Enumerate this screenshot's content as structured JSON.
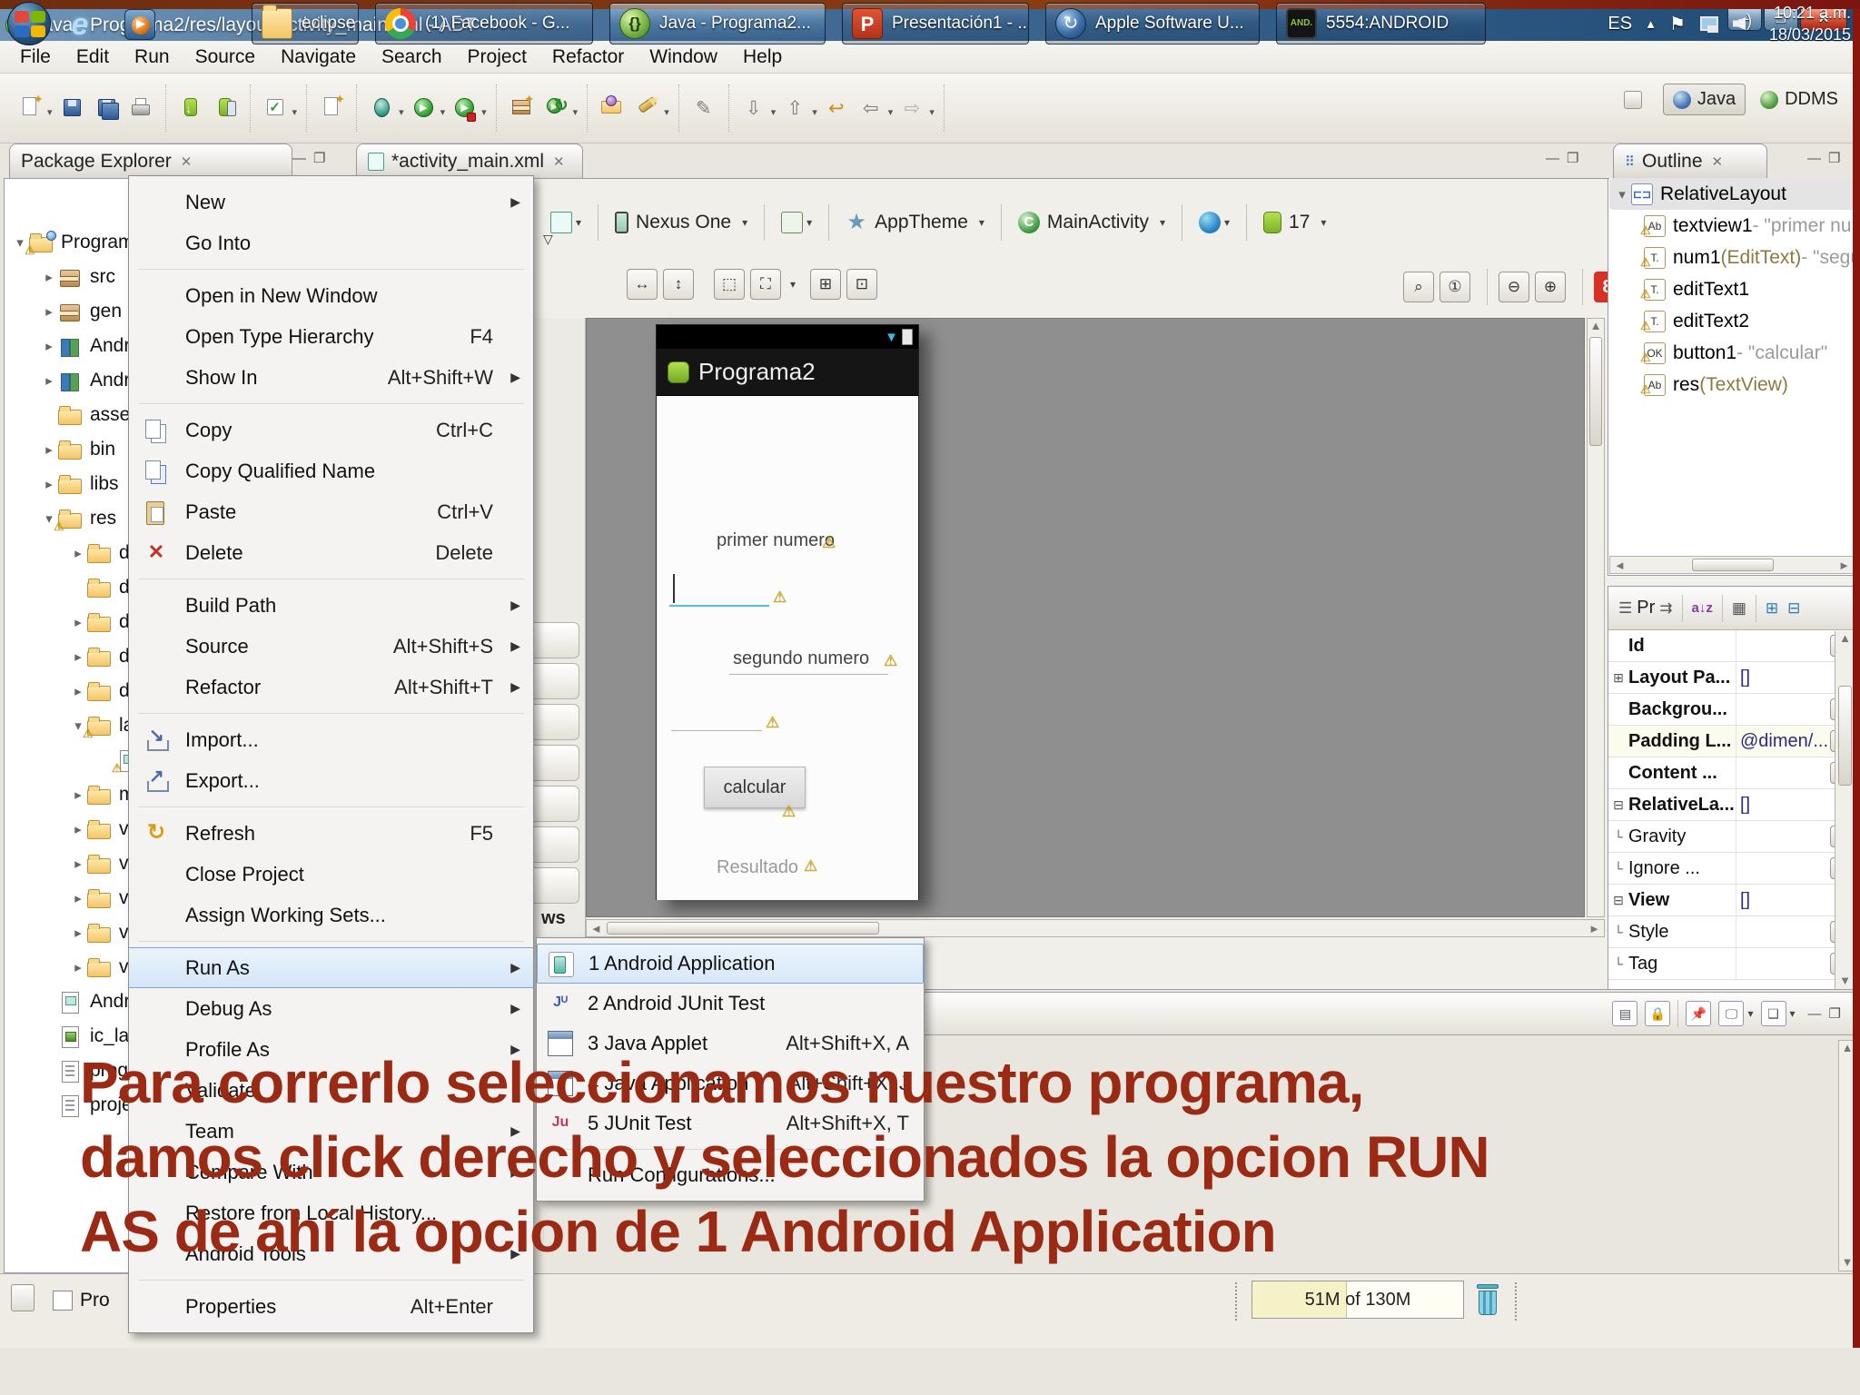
{
  "icons": {
    "warn": "⚠",
    "close": "✕",
    "minimize": "—",
    "maximize": "❐",
    "tab_close": "✕",
    "tri_c": "▸",
    "tri_e": "▾",
    "sub_arrow": "▶",
    "dd": "▾",
    "left": "◄",
    "right": "►",
    "up": "▲",
    "down": "▼",
    "dots": "···",
    "plus": "+",
    "minus": "-",
    "check": "✓",
    "refresh": "↻",
    "run": "▶",
    "sig": "▼",
    "back": "⇦",
    "forward": "⇨",
    "next": "⇩",
    "prev": "⇧",
    "lastedit": "↩",
    "occurrences": "✎",
    "spark": "✦",
    "az": "a↓z",
    "grid": "▦",
    "rows": "☰",
    "pin": "⇉",
    "view_menu": "▽"
  },
  "window": {
    "title": "Java - Programa2/res/layout/activity_main.xml - ADT"
  },
  "menubar": {
    "items": [
      "File",
      "Edit",
      "Run",
      "Source",
      "Navigate",
      "Search",
      "Project",
      "Refactor",
      "Window",
      "Help"
    ]
  },
  "toolbar": {
    "groups": [
      [
        "new*",
        "save",
        "saveall",
        "print"
      ],
      [
        "sdk",
        "avd"
      ],
      [
        "check*"
      ],
      [
        "newdroid"
      ],
      [
        "debug*",
        "run*",
        "runsec*"
      ],
      [
        "pkgnew",
        "ext*"
      ],
      [
        "opentype",
        "searchtool*"
      ],
      [
        "occurrences"
      ],
      [
        "nextann*",
        "prevann*",
        "lastedit",
        "back*",
        "fwd*"
      ]
    ]
  },
  "perspectives": {
    "java": "Java",
    "ddms": "DDMS"
  },
  "package_explorer": {
    "title": "Package Explorer",
    "tree": [
      {
        "label": "Program",
        "depth": 0,
        "arrow": "e",
        "icon": "project",
        "warn": true
      },
      {
        "label": "src",
        "depth": 1,
        "arrow": "c",
        "icon": "pkg"
      },
      {
        "label": "gen [",
        "depth": 1,
        "arrow": "c",
        "icon": "pkg"
      },
      {
        "label": "Andr",
        "depth": 1,
        "arrow": "c",
        "icon": "lib"
      },
      {
        "label": "Andr",
        "depth": 1,
        "arrow": "c",
        "icon": "lib"
      },
      {
        "label": "assets",
        "depth": 1,
        "icon": "folder"
      },
      {
        "label": "bin",
        "depth": 1,
        "arrow": "c",
        "icon": "folder"
      },
      {
        "label": "libs",
        "depth": 1,
        "arrow": "c",
        "icon": "folder"
      },
      {
        "label": "res",
        "depth": 1,
        "arrow": "e",
        "icon": "folder",
        "warn": true
      },
      {
        "label": "dr",
        "depth": 2,
        "arrow": "c",
        "icon": "folder"
      },
      {
        "label": "dr",
        "depth": 2,
        "icon": "folder"
      },
      {
        "label": "dr",
        "depth": 2,
        "arrow": "c",
        "icon": "folder"
      },
      {
        "label": "dr",
        "depth": 2,
        "arrow": "c",
        "icon": "folder"
      },
      {
        "label": "dr",
        "depth": 2,
        "arrow": "c",
        "icon": "folder"
      },
      {
        "label": "la",
        "depth": 2,
        "arrow": "e",
        "icon": "folder",
        "warn": true
      },
      {
        "label": "",
        "depth": 3,
        "icon": "xml",
        "warn": true
      },
      {
        "label": "m",
        "depth": 2,
        "arrow": "c",
        "icon": "folder"
      },
      {
        "label": "va",
        "depth": 2,
        "arrow": "c",
        "icon": "folder"
      },
      {
        "label": "va",
        "depth": 2,
        "arrow": "c",
        "icon": "folder"
      },
      {
        "label": "va",
        "depth": 2,
        "arrow": "c",
        "icon": "folder"
      },
      {
        "label": "va",
        "depth": 2,
        "arrow": "c",
        "icon": "folder"
      },
      {
        "label": "va",
        "depth": 2,
        "arrow": "c",
        "icon": "folder"
      },
      {
        "label": "Andr",
        "depth": 1,
        "icon": "xml"
      },
      {
        "label": "ic_lau",
        "depth": 1,
        "icon": "img"
      },
      {
        "label": "progu",
        "depth": 1,
        "icon": "file"
      },
      {
        "label": "proje",
        "depth": 1,
        "icon": "file"
      }
    ]
  },
  "editor": {
    "tab": "*activity_main.xml",
    "palette_hint": "ws",
    "zoom_badge": "8",
    "config": {
      "device": "Nexus One",
      "theme": "AppTheme",
      "activity": "MainActivity",
      "api": "17"
    },
    "preview": {
      "app_title": "Programa2",
      "label1": "primer numero",
      "label2": "segundo numero",
      "button": "calcular",
      "result": "Resultado"
    }
  },
  "outline": {
    "title": "Outline",
    "items": [
      {
        "label": "RelativeLayout",
        "icon": "layout",
        "depth": 0,
        "selected": true
      },
      {
        "label": "textview1",
        "suffix": " - \"primer nu",
        "icon": "ab",
        "depth": 1,
        "warn": true
      },
      {
        "label": "num1",
        "type": " (EditText)",
        "suffix": " - \"segu",
        "icon": "tf",
        "depth": 1,
        "warn": true
      },
      {
        "label": "editText1",
        "icon": "tf",
        "depth": 1,
        "warn": true
      },
      {
        "label": "editText2",
        "icon": "tf",
        "depth": 1,
        "warn": true
      },
      {
        "label": "button1",
        "suffix": " - \"calcular\"",
        "icon": "ok",
        "depth": 1,
        "warn": true
      },
      {
        "label": "res",
        "type": " (TextView)",
        "icon": "ab",
        "depth": 1,
        "warn": true
      }
    ]
  },
  "properties": {
    "title": "Pr",
    "rows": [
      {
        "name": "Id",
        "btn": true
      },
      {
        "name": "Layout Pa...",
        "value": "[]",
        "expand": "plus"
      },
      {
        "name": "Backgrou...",
        "btn": true
      },
      {
        "name": "Padding L...",
        "value": "@dimen/...",
        "btn": true,
        "highlight": true
      },
      {
        "name": "Content ...",
        "btn": true
      },
      {
        "name": "RelativeLa...",
        "value": "[]",
        "expand": "minus"
      },
      {
        "name": "Gravity",
        "btn": true,
        "indent": true
      },
      {
        "name": "Ignore ...",
        "btn": true,
        "indent": true
      },
      {
        "name": "View",
        "value": "[]",
        "expand": "minus"
      },
      {
        "name": "Style",
        "btn": true,
        "indent": true
      },
      {
        "name": "Tag",
        "btn": true,
        "indent": true
      }
    ]
  },
  "context_menu": {
    "items": [
      {
        "label": "New",
        "submenu": true
      },
      {
        "label": "Go Into"
      },
      {
        "sep": true
      },
      {
        "label": "Open in New Window"
      },
      {
        "label": "Open Type Hierarchy",
        "shortcut": "F4"
      },
      {
        "label": "Show In",
        "shortcut": "Alt+Shift+W",
        "submenu": true
      },
      {
        "sep": true
      },
      {
        "label": "Copy",
        "shortcut": "Ctrl+C",
        "icon": "copy"
      },
      {
        "label": "Copy Qualified Name",
        "icon": "copyq"
      },
      {
        "label": "Paste",
        "shortcut": "Ctrl+V",
        "icon": "paste"
      },
      {
        "label": "Delete",
        "shortcut": "Delete",
        "icon": "delete"
      },
      {
        "sep": true
      },
      {
        "label": "Build Path",
        "submenu": true
      },
      {
        "label": "Source",
        "shortcut": "Alt+Shift+S",
        "submenu": true
      },
      {
        "label": "Refactor",
        "shortcut": "Alt+Shift+T",
        "submenu": true
      },
      {
        "sep": true
      },
      {
        "label": "Import...",
        "icon": "import"
      },
      {
        "label": "Export...",
        "icon": "export"
      },
      {
        "sep": true
      },
      {
        "label": "Refresh",
        "shortcut": "F5",
        "icon": "refresh"
      },
      {
        "label": "Close Project"
      },
      {
        "label": "Assign Working Sets..."
      },
      {
        "sep": true
      },
      {
        "label": "Run As",
        "submenu": true,
        "highlight": true
      },
      {
        "label": "Debug As",
        "submenu": true
      },
      {
        "label": "Profile As",
        "submenu": true
      },
      {
        "label": "Validate"
      },
      {
        "label": "Team",
        "submenu": true
      },
      {
        "label": "Compare With",
        "submenu": true
      },
      {
        "label": "Restore from Local History..."
      },
      {
        "label": "Android Tools",
        "submenu": true
      },
      {
        "sep": true
      },
      {
        "label": "Properties",
        "shortcut": "Alt+Enter"
      }
    ]
  },
  "run_as_submenu": {
    "items": [
      {
        "label": "1 Android Application",
        "icon": "android",
        "selected": true
      },
      {
        "label": "2 Android JUnit Test",
        "icon": "juandroid"
      },
      {
        "label": "3 Java Applet",
        "shortcut": "Alt+Shift+X, A",
        "icon": "japplet"
      },
      {
        "label": "4 Java Application",
        "shortcut": "Alt+Shift+X, J",
        "icon": "japp"
      },
      {
        "label": "5 JUnit Test",
        "shortcut": "Alt+Shift+X, T",
        "icon": "junit"
      },
      {
        "sep": true
      },
      {
        "label": "Run Configurations..."
      }
    ]
  },
  "overlay": {
    "line1": "Para correrlo seleccionamos nuestro programa,",
    "line2": "damos click derecho y seleccionados la opcion RUN",
    "line3": "AS de ahí la opcion de 1 Android Application"
  },
  "status": {
    "heap": "51M of 130M",
    "bottom_tab": "Pro"
  },
  "taskbar": {
    "buttons": [
      {
        "label": "eclipse",
        "icon": "folder"
      },
      {
        "label": "(1) Facebook - G...",
        "icon": "chrome"
      },
      {
        "label": "Java - Programa2...",
        "icon": "eclipse",
        "active": true
      },
      {
        "label": "Presentación1 - ...",
        "icon": "ppt"
      },
      {
        "label": "Apple Software U...",
        "icon": "apple"
      },
      {
        "label": "5554:ANDROID",
        "icon": "androidemu"
      }
    ],
    "tray": {
      "lang": "ES",
      "time": "10:21 a.m.",
      "date": "18/03/2015"
    }
  }
}
